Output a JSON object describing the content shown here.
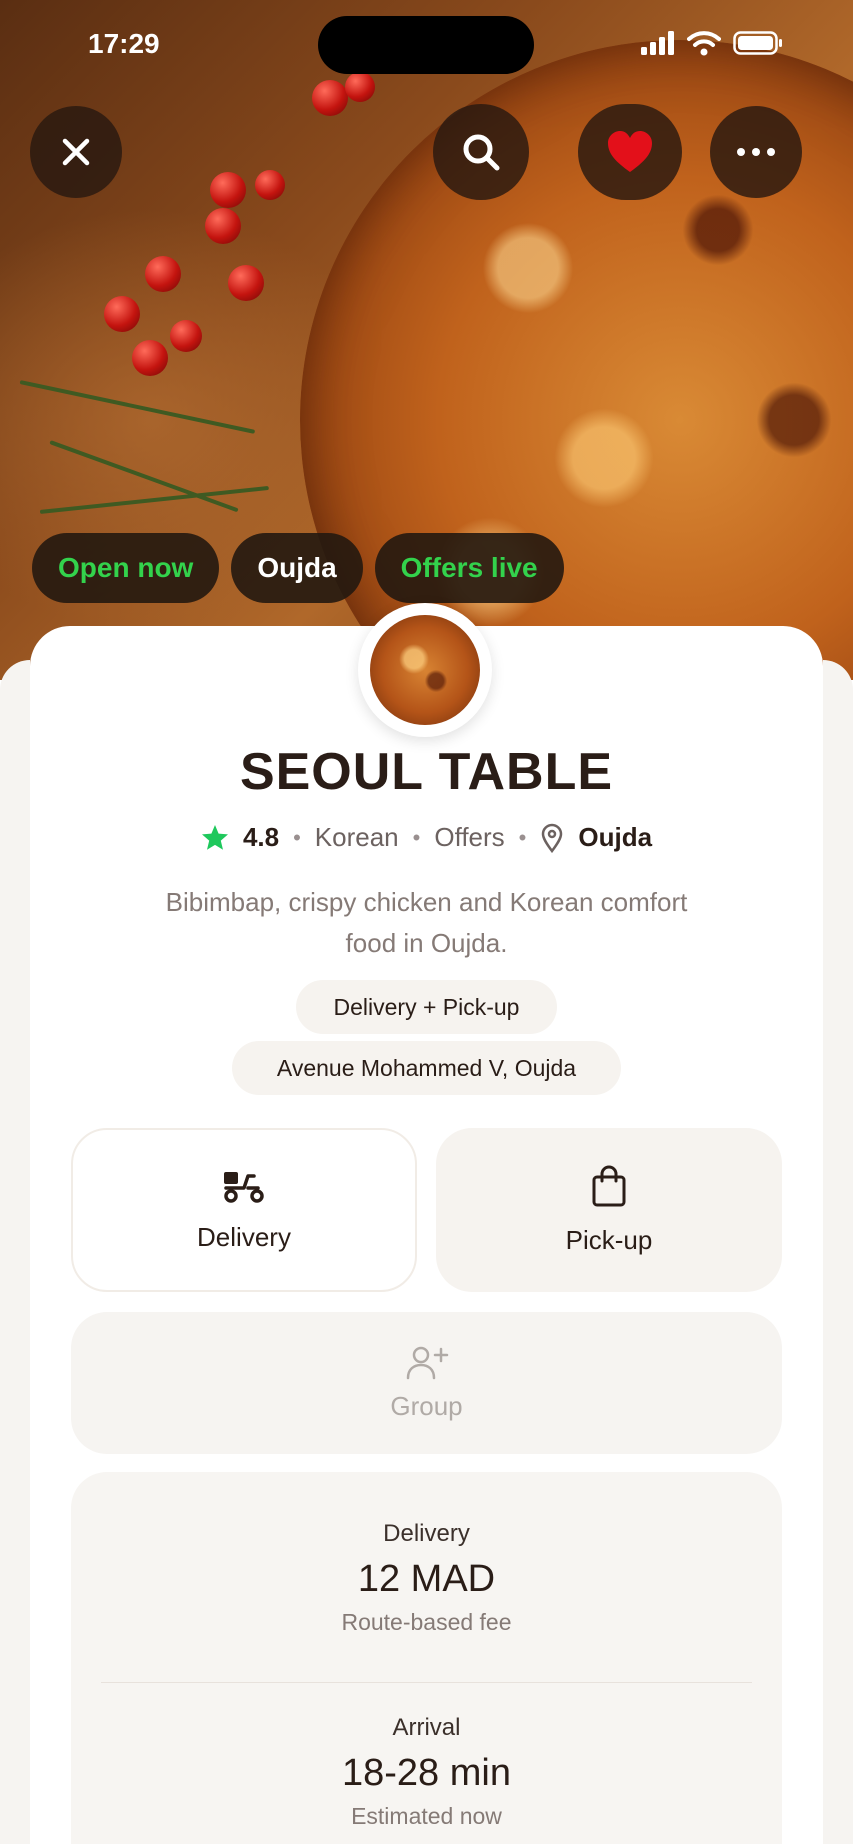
{
  "status_bar": {
    "time": "17:29"
  },
  "hero": {
    "chips": [
      {
        "label": "Open now",
        "color": "#33d24c"
      },
      {
        "label": "Oujda",
        "color": "#ffffff"
      },
      {
        "label": "Offers live",
        "color": "#33d24c"
      }
    ],
    "favorite_color": "#e3101a"
  },
  "restaurant": {
    "name": "SEOUL TABLE",
    "rating": "4.8",
    "cuisine": "Korean",
    "offers": "Offers",
    "city": "Oujda",
    "description": "Bibimbap, crispy chicken and Korean comfort food in Oujda.",
    "service_tag": "Delivery + Pick-up",
    "address": "Avenue Mohammed V, Oujda"
  },
  "modes": {
    "delivery_label": "Delivery",
    "pickup_label": "Pick-up",
    "group_label": "Group"
  },
  "info": {
    "delivery_label": "Delivery",
    "delivery_value": "12 MAD",
    "delivery_sub": "Route-based fee",
    "arrival_label": "Arrival",
    "arrival_value": "18-28 min",
    "arrival_sub": "Estimated now"
  },
  "colors": {
    "accent_green": "#33d24c",
    "star_green": "#1ec85c",
    "dark_text": "#2a1d17"
  }
}
